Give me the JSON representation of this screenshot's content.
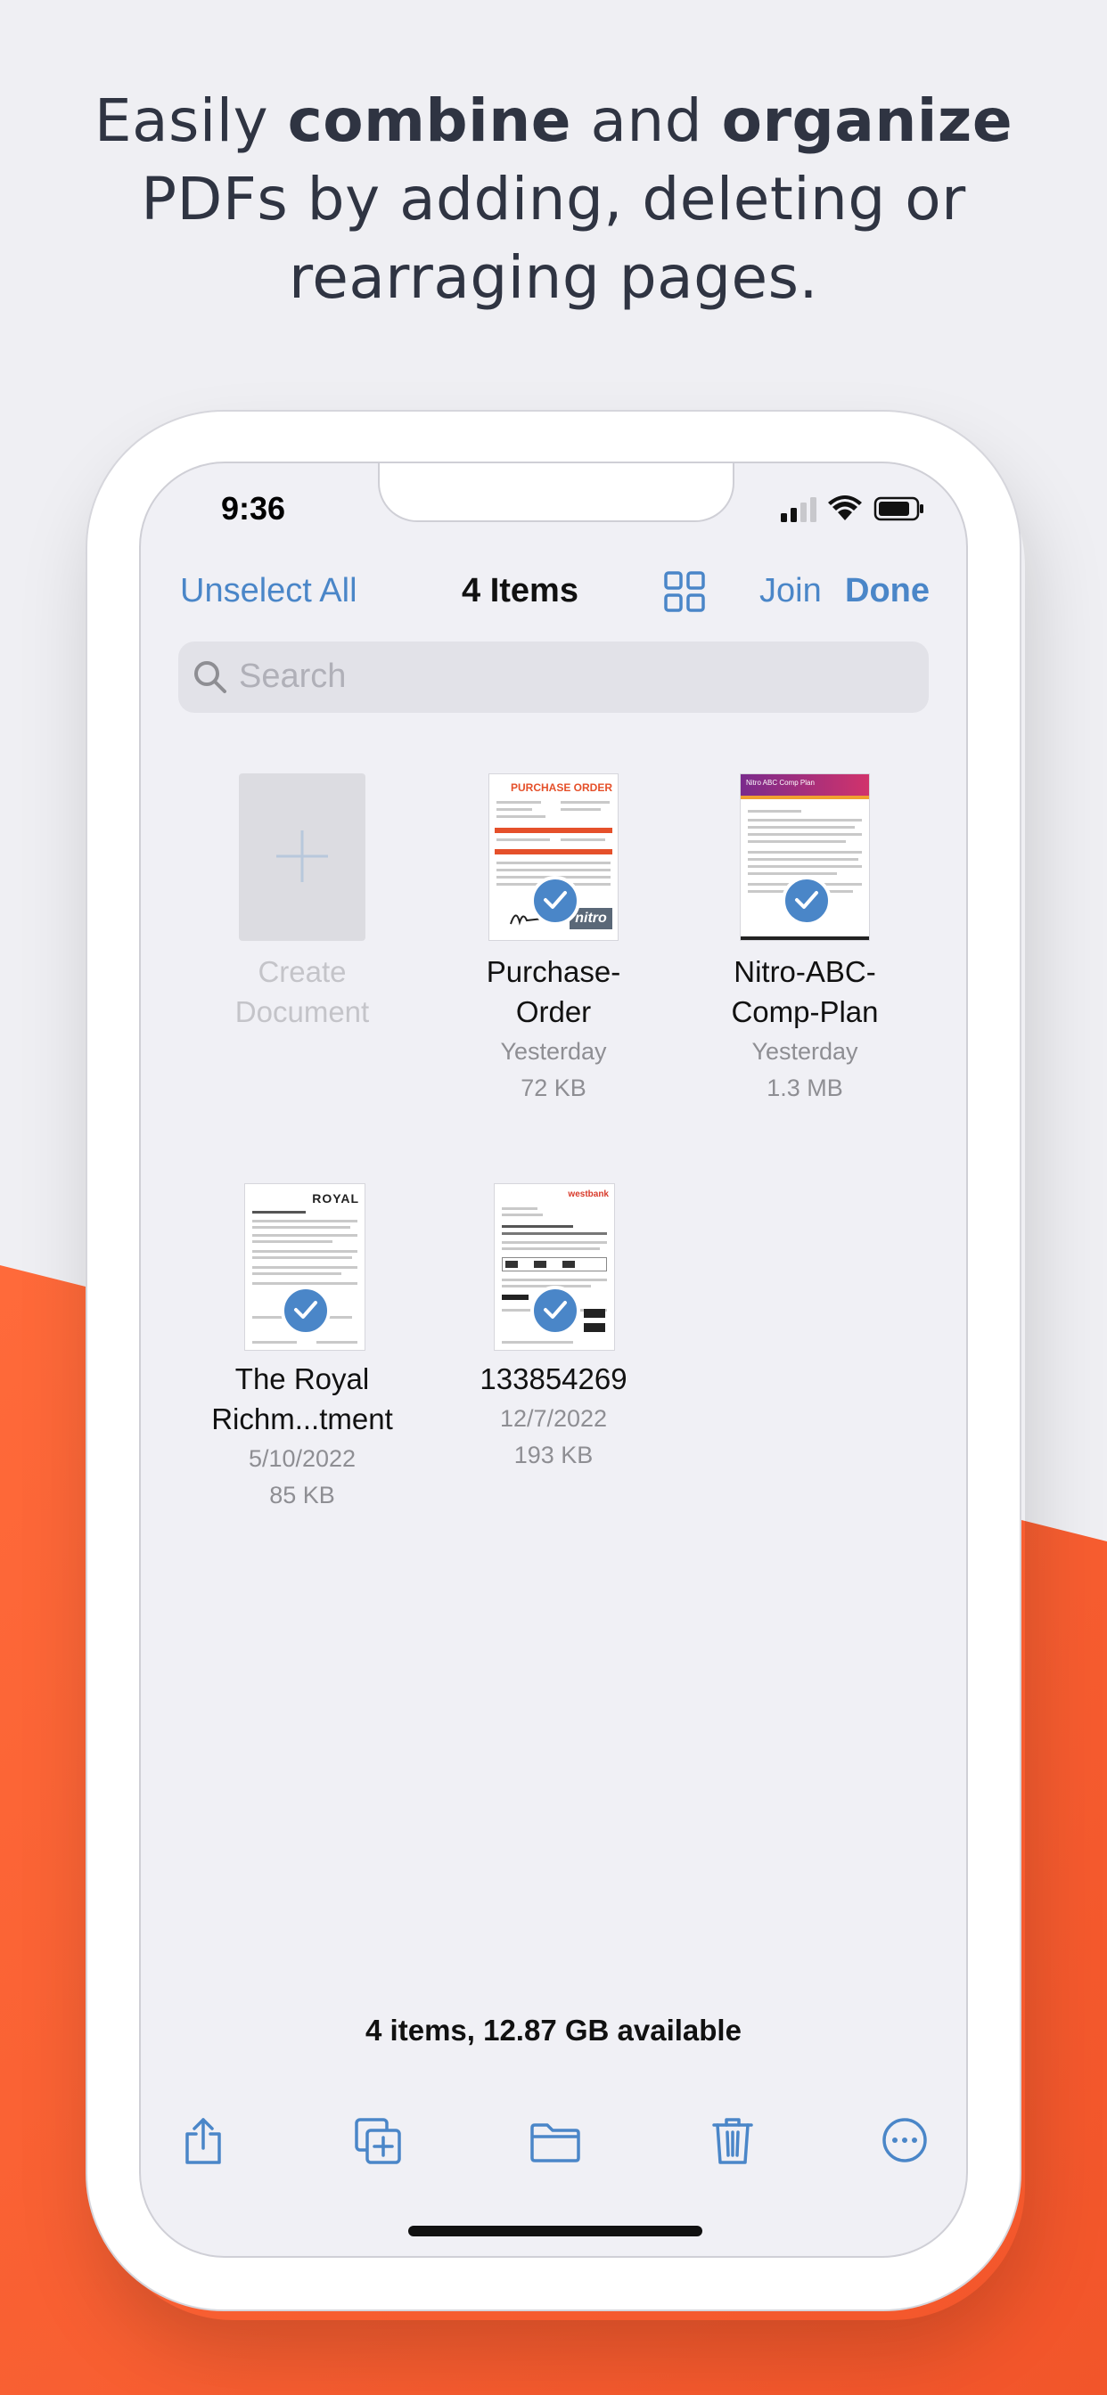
{
  "headline": {
    "part1": "Easily ",
    "bold1": "combine",
    "part2": " and ",
    "bold2": "organize",
    "line2": "PDFs by adding, deleting or",
    "line3": "rearraging pages."
  },
  "colors": {
    "accent": "#4a86c8",
    "background": "#efeff3",
    "orange": "#ff5a2b"
  },
  "status_bar": {
    "time": "9:36"
  },
  "nav": {
    "unselect_all": "Unselect All",
    "title": "4 Items",
    "join": "Join",
    "done": "Done",
    "grid_icon": "grid-view-icon"
  },
  "search": {
    "placeholder": "Search"
  },
  "create": {
    "line1": "Create",
    "line2": "Document"
  },
  "documents": [
    {
      "name1": "Purchase-",
      "name2": "Order",
      "date": "Yesterday",
      "size": "72 KB",
      "selected": true
    },
    {
      "name1": "Nitro-ABC-",
      "name2": "Comp-Plan",
      "date": "Yesterday",
      "size": "1.3 MB",
      "selected": true
    },
    {
      "name1": "The Royal",
      "name2": "Richm...tment",
      "date": "5/10/2022",
      "size": "85 KB",
      "selected": true
    },
    {
      "name1": "133854269",
      "name2": "",
      "date": "12/7/2022",
      "size": "193 KB",
      "selected": true
    }
  ],
  "thumb_text": {
    "po_header": "PURCHASE ORDER",
    "po_brand": "nitro",
    "royal_logo": "ROYAL",
    "abc_header": "Nitro ABC Comp Plan",
    "bank_logo": "westbank"
  },
  "footer": {
    "summary": "4 items, 12.87 GB available"
  },
  "toolbar": [
    "share-icon",
    "duplicate-icon",
    "folder-icon",
    "trash-icon",
    "more-icon"
  ]
}
